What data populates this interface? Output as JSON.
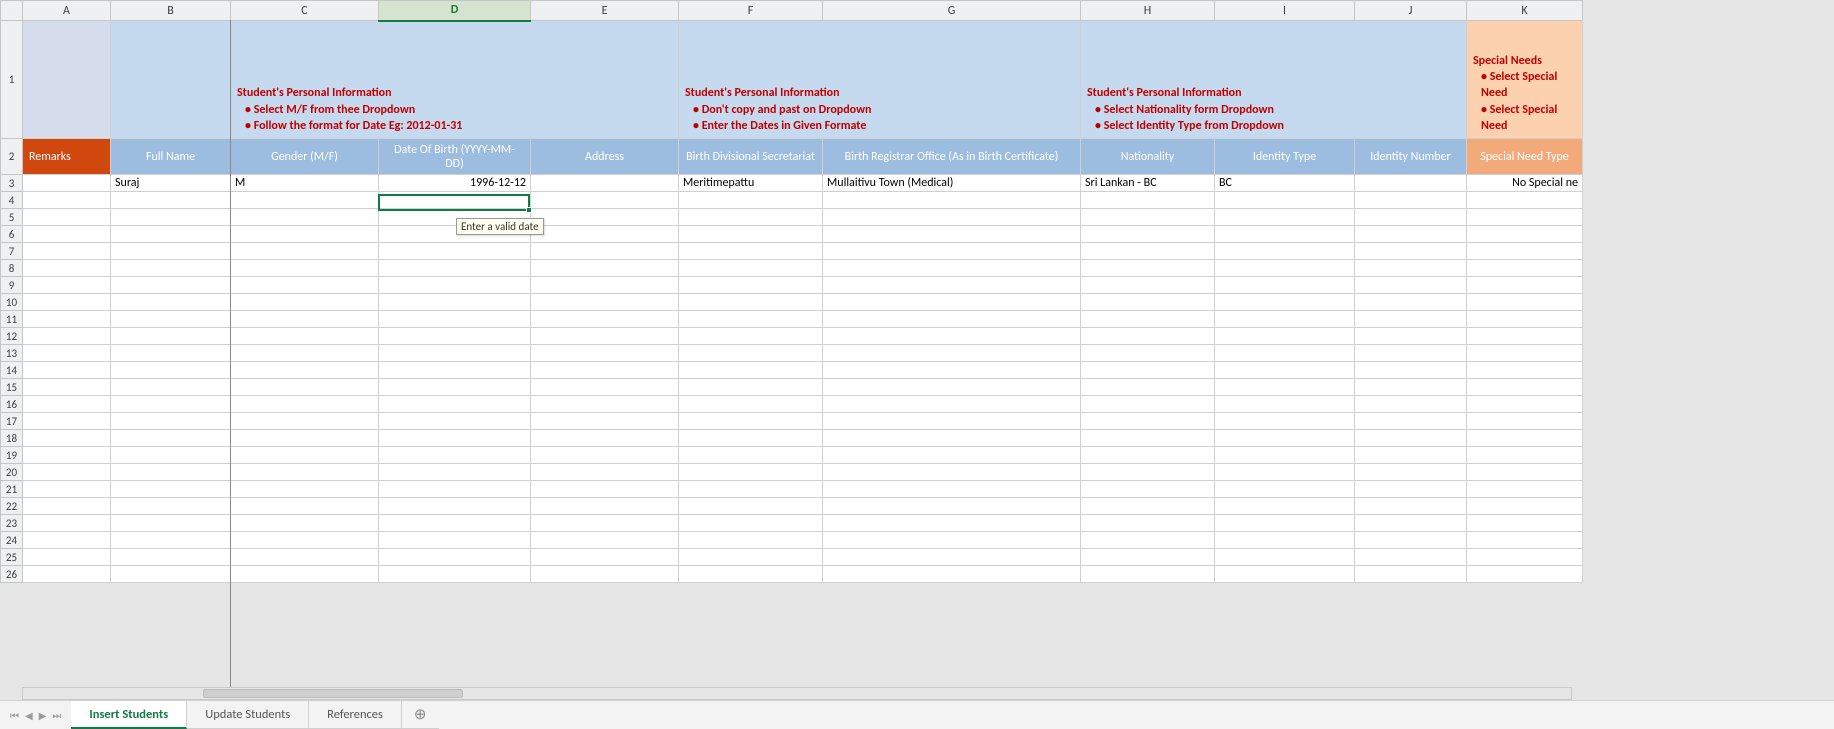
{
  "columns": [
    "A",
    "B",
    "C",
    "D",
    "E",
    "F",
    "G",
    "H",
    "I",
    "J",
    "K"
  ],
  "active_column": "D",
  "row_numbers": [
    1,
    2,
    3,
    4,
    5,
    6,
    7,
    8,
    9,
    10,
    11,
    12,
    13,
    14,
    15,
    16,
    17,
    18,
    19,
    20,
    21,
    22,
    23,
    24,
    25,
    26
  ],
  "instructions": {
    "group1": {
      "title": "Student's Personal Information",
      "lines": [
        "Select M/F from thee Dropdown",
        "Follow the format for Date Eg: 2012-01-31"
      ]
    },
    "group2": {
      "title": "Student's Personal Information",
      "lines": [
        "Don't copy and past on Dropdown",
        "Enter the Dates in Given Formate"
      ]
    },
    "group3": {
      "title": "Student's Personal Information",
      "lines": [
        "Select Nationality form Dropdown",
        "Select Identity Type from Dropdown"
      ]
    },
    "group4": {
      "title": "Special Needs",
      "lines": [
        "Select Special Need",
        "Select Special Need"
      ]
    }
  },
  "headers": {
    "A": "Remarks",
    "B": "Full Name",
    "C": "Gender (M/F)",
    "D": "Date Of Birth (YYYY-MM-DD)",
    "E": "Address",
    "F": "Birth Divisional Secretariat",
    "G": "Birth Registrar Office  (As in Birth Certificate)",
    "H": "Nationality",
    "I": "Identity Type",
    "J": "Identity  Number",
    "K": "Special Need Type"
  },
  "row3": {
    "B": "Suraj",
    "C": "M",
    "D": "1996-12-12",
    "F": "Meritimepattu",
    "G": "Mullaitivu Town (Medical)",
    "H": "Sri Lankan - BC",
    "I": "BC",
    "K": "No Special ne"
  },
  "tooltip": "Enter a valid date",
  "tabs": {
    "active": "Insert Students",
    "others": [
      "Update Students",
      "References"
    ],
    "nav": [
      "⏮",
      "◀",
      "▶",
      "⏭"
    ]
  }
}
